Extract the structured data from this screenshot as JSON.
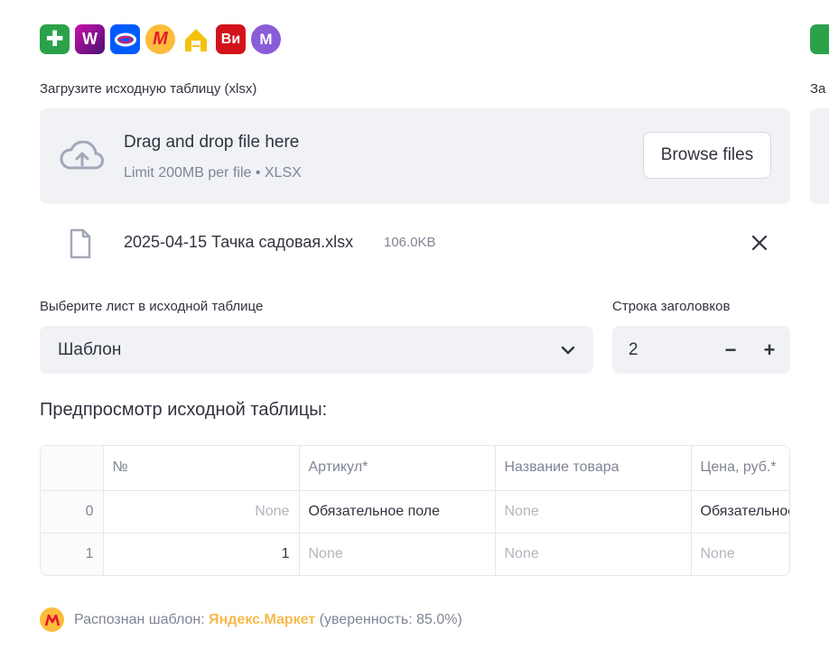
{
  "marketplaces": [
    {
      "name": "megamarket",
      "icon": "plus-cross-icon",
      "color": "#2ba14a",
      "glyph": "✚"
    },
    {
      "name": "wildberries",
      "icon": "wildberries-logo-icon",
      "color": "#8f14ce",
      "glyph": "W"
    },
    {
      "name": "ozon",
      "icon": "ozon-logo-icon",
      "color": "#005bff",
      "glyph": "O"
    },
    {
      "name": "yandex-market",
      "icon": "yandex-market-logo-icon",
      "color": "#fdbc3b",
      "glyph": "M"
    },
    {
      "name": "house",
      "icon": "house-logo-icon",
      "color": "#f4c20d",
      "glyph": "⌂"
    },
    {
      "name": "vseinstrumenti",
      "icon": "vi-logo-icon",
      "color": "#d3131b",
      "glyph": "Ви"
    },
    {
      "name": "magnit",
      "icon": "m-logo-icon",
      "color": "#8a5cd8",
      "glyph": "M"
    }
  ],
  "upload": {
    "label": "Загрузите исходную таблицу (xlsx)",
    "title": "Drag and drop file here",
    "limit": "Limit 200MB per file • XLSX",
    "browse_label": "Browse files"
  },
  "file": {
    "name": "2025-04-15 Тачка садовая.xlsx",
    "size": "106.0KB"
  },
  "sheet_select": {
    "label": "Выберите лист в исходной таблице",
    "value": "Шаблон"
  },
  "header_row": {
    "label": "Строка заголовков",
    "value": "2",
    "minus": "−",
    "plus": "+"
  },
  "preview": {
    "title": "Предпросмотр исходной таблицы:",
    "columns": [
      "",
      "№",
      "Артикул*",
      "Название товара",
      "Цена, руб.*"
    ],
    "rows": [
      [
        "0",
        "None",
        "Обязательное поле",
        "None",
        "Обязательное поле"
      ],
      [
        "1",
        "1",
        "None",
        "None",
        "None"
      ]
    ]
  },
  "detected": {
    "prefix": "Распознан шаблон:",
    "brand": "Яндекс.Маркет",
    "confidence": "(уверенность: 85.0%)"
  },
  "right_clip": {
    "label": "За"
  }
}
